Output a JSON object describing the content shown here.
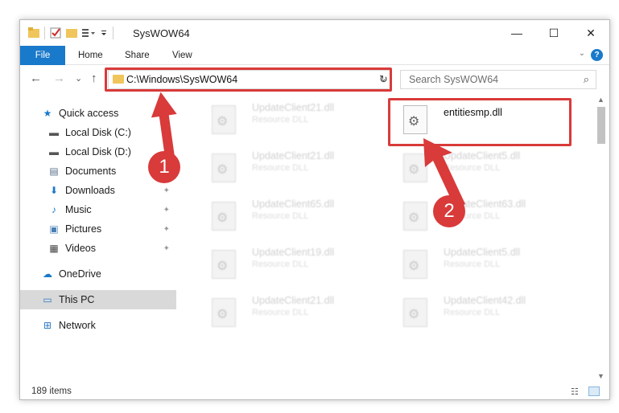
{
  "window": {
    "title": "SysWOW64",
    "controls": {
      "minimize": "—",
      "maximize": "☐",
      "close": "✕"
    }
  },
  "ribbon": {
    "tabs": [
      "File",
      "Home",
      "Share",
      "View"
    ],
    "help": "?",
    "accent": "#1979ca"
  },
  "navigation": {
    "back": "←",
    "forward": "→",
    "recent": "⌄",
    "up": "↑",
    "address": "C:\\Windows\\SysWOW64",
    "refresh": "↻",
    "search_placeholder": "Search SysWOW64"
  },
  "sidebar": {
    "items": [
      {
        "label": "Quick access",
        "icon": "star-icon",
        "glyph": "★",
        "color": "#1979ca",
        "pinned": false,
        "indent": false
      },
      {
        "label": "Local Disk (C:)",
        "icon": "drive-icon",
        "glyph": "▬",
        "color": "#555555",
        "pinned": true,
        "indent": true
      },
      {
        "label": "Local Disk (D:)",
        "icon": "drive-icon",
        "glyph": "▬",
        "color": "#555555",
        "pinned": true,
        "indent": true
      },
      {
        "label": "Documents",
        "icon": "documents-icon",
        "glyph": "▤",
        "color": "#5a6e8a",
        "pinned": true,
        "indent": true
      },
      {
        "label": "Downloads",
        "icon": "download-icon",
        "glyph": "⬇",
        "color": "#1979ca",
        "pinned": true,
        "indent": true
      },
      {
        "label": "Music",
        "icon": "music-icon",
        "glyph": "♪",
        "color": "#1979ca",
        "pinned": true,
        "indent": true
      },
      {
        "label": "Pictures",
        "icon": "pictures-icon",
        "glyph": "▣",
        "color": "#4a7fb5",
        "pinned": true,
        "indent": true
      },
      {
        "label": "Videos",
        "icon": "video-icon",
        "glyph": "▦",
        "color": "#444444",
        "pinned": true,
        "indent": true
      },
      {
        "label": "OneDrive",
        "icon": "cloud-icon",
        "glyph": "☁",
        "color": "#1979ca",
        "pinned": false,
        "indent": false
      },
      {
        "label": "This PC",
        "icon": "computer-icon",
        "glyph": "▭",
        "color": "#2b78c2",
        "pinned": false,
        "indent": false,
        "selected": true
      },
      {
        "label": "Network",
        "icon": "network-icon",
        "glyph": "⊞",
        "color": "#2b78c2",
        "pinned": false,
        "indent": false
      }
    ]
  },
  "files": [
    {
      "name": "UpdateClient21.dll",
      "type": "Resource DLL",
      "clear": false
    },
    {
      "name": "entitiesmp.dll",
      "type": "",
      "clear": true
    },
    {
      "name": "UpdateClient21.dll",
      "type": "Resource DLL",
      "clear": false
    },
    {
      "name": "UpdateClient5.dll",
      "type": "Resource DLL",
      "clear": false
    },
    {
      "name": "UpdateClient65.dll",
      "type": "Resource DLL",
      "clear": false
    },
    {
      "name": "UpdateClient63.dll",
      "type": "Resource DLL",
      "clear": false
    },
    {
      "name": "UpdateClient19.dll",
      "type": "Resource DLL",
      "clear": false
    },
    {
      "name": "UpdateClient5.dll",
      "type": "Resource DLL",
      "clear": false
    },
    {
      "name": "UpdateClient21.dll",
      "type": "Resource DLL",
      "clear": false
    },
    {
      "name": "UpdateClient42.dll",
      "type": "Resource DLL",
      "clear": false
    }
  ],
  "status": {
    "items": "189 items"
  },
  "annotations": {
    "badge1": "1",
    "badge2": "2",
    "color": "#d93a3a"
  }
}
